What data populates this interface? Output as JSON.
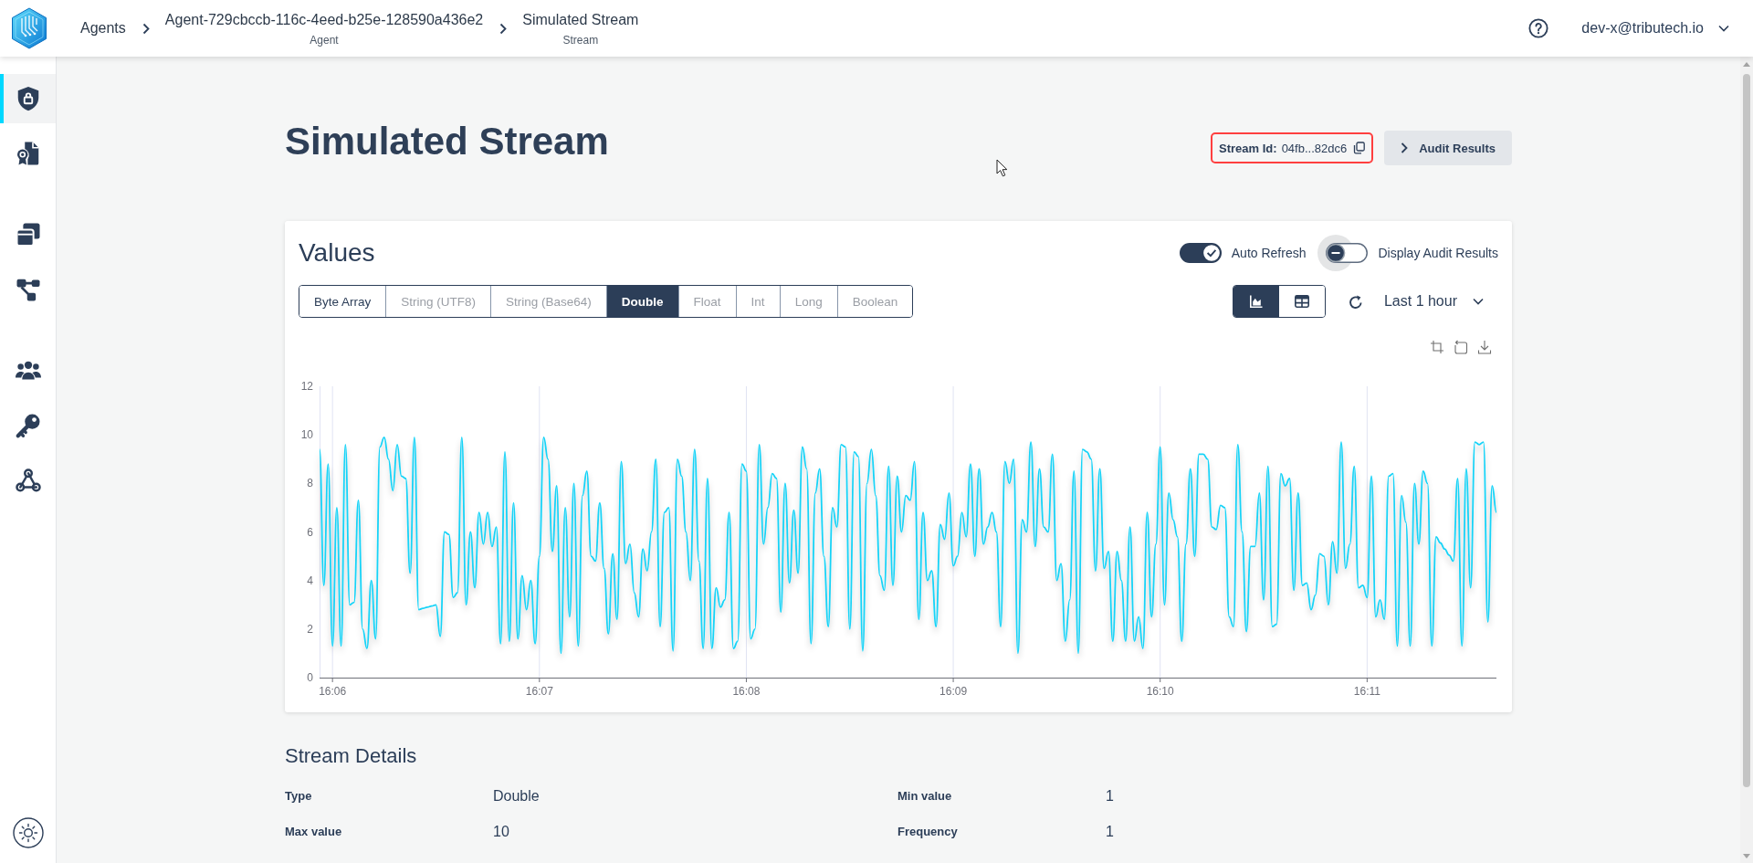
{
  "top_bar": {
    "breadcrumbs": [
      {
        "label": "Agents"
      },
      {
        "label": "Agent-729cbccb-116c-4eed-b25e-128590a436e2",
        "caption": "Agent"
      },
      {
        "label": "Simulated Stream",
        "caption": "Stream"
      }
    ],
    "user": "dev-x@tributech.io"
  },
  "sidebar": {
    "groups": [
      {
        "items": [
          {
            "selected": true
          },
          {
            "selected": false
          }
        ]
      },
      {
        "items": [
          {
            "selected": false
          },
          {
            "selected": false
          }
        ]
      },
      {
        "items": [
          {
            "selected": false
          },
          {
            "selected": false
          },
          {
            "selected": false
          }
        ]
      }
    ]
  },
  "header": {
    "title": "Simulated Stream",
    "stream_id": {
      "label": "Stream Id:",
      "value": "04fb...82dc6",
      "highlighted": true
    },
    "audit_button": "Audit Results"
  },
  "values_card": {
    "title": "Values",
    "toggles": [
      {
        "label": "Auto Refresh",
        "on": true,
        "focused": false
      },
      {
        "label": "Display Audit Results",
        "on": false,
        "focused": true
      }
    ],
    "type_tabs": [
      {
        "label": "Byte Array",
        "selected": false,
        "disabled": false
      },
      {
        "label": "String (UTF8)",
        "selected": false,
        "disabled": true
      },
      {
        "label": "String (Base64)",
        "selected": false,
        "disabled": true
      },
      {
        "label": "Double",
        "selected": true,
        "disabled": false
      },
      {
        "label": "Float",
        "selected": false,
        "disabled": true
      },
      {
        "label": "Int",
        "selected": false,
        "disabled": true
      },
      {
        "label": "Long",
        "selected": false,
        "disabled": true
      },
      {
        "label": "Boolean",
        "selected": false,
        "disabled": true
      }
    ],
    "views": [
      {
        "selected": true
      },
      {
        "selected": false
      }
    ],
    "time_range": "Last 1 hour",
    "chart_data": {
      "type": "line",
      "categories": [
        null,
        null,
        null,
        "16:06",
        null,
        null,
        null,
        null,
        null,
        null,
        null,
        null,
        null,
        null,
        null,
        null,
        null,
        null,
        null,
        null,
        null,
        null,
        null,
        null,
        null,
        null,
        null,
        null,
        null,
        null,
        null,
        null,
        null,
        null,
        null,
        null,
        null,
        null,
        null,
        null,
        null,
        null,
        null,
        null,
        null,
        null,
        null,
        null,
        null,
        null,
        null,
        "16:07",
        null,
        null,
        null,
        null,
        null,
        null,
        null,
        null,
        null,
        null,
        null,
        null,
        null,
        null,
        null,
        null,
        null,
        null,
        null,
        null,
        null,
        null,
        null,
        null,
        null,
        null,
        null,
        null,
        null,
        null,
        null,
        null,
        null,
        null,
        null,
        null,
        null,
        null,
        null,
        null,
        null,
        null,
        null,
        null,
        null,
        null,
        null,
        "16:08",
        null,
        null,
        null,
        null,
        null,
        null,
        null,
        null,
        null,
        null,
        null,
        null,
        null,
        null,
        null,
        null,
        null,
        null,
        null,
        null,
        null,
        null,
        null,
        null,
        null,
        null,
        null,
        null,
        null,
        null,
        null,
        null,
        null,
        null,
        null,
        null,
        null,
        null,
        null,
        null,
        null,
        null,
        null,
        null,
        null,
        null,
        null,
        "16:09",
        null,
        null,
        null,
        null,
        null,
        null,
        null,
        null,
        null,
        null,
        null,
        null,
        null,
        null,
        null,
        null,
        null,
        null,
        null,
        null,
        null,
        null,
        null,
        null,
        null,
        null,
        null,
        null,
        null,
        null,
        null,
        null,
        null,
        null,
        null,
        null,
        null,
        null,
        null,
        null,
        null,
        null,
        null,
        null,
        null,
        null,
        null,
        "16:10",
        null,
        null,
        null,
        null,
        null,
        null,
        null,
        null,
        null,
        null,
        null,
        null,
        null,
        null,
        null,
        null,
        null,
        null,
        null,
        null,
        null,
        null,
        null,
        null,
        null,
        null,
        null,
        null,
        null,
        null,
        null,
        null,
        null,
        null,
        null,
        null,
        null,
        null,
        null,
        null,
        null,
        null,
        null,
        null,
        null,
        null,
        null,
        "16:11",
        null,
        null,
        null,
        null,
        null,
        null,
        null,
        null,
        null,
        null,
        null,
        null,
        null,
        null,
        null,
        null,
        null,
        null,
        null,
        null,
        null,
        null,
        null,
        null,
        null,
        null,
        null,
        null,
        null,
        null
      ],
      "series": [
        {
          "color": "#19d3f7",
          "values": [
            9.4,
            3.8,
            8.8,
            1.3,
            7.0,
            1.3,
            9.6,
            3.0,
            3.1,
            7.3,
            2.0,
            1.2,
            4.0,
            1.6,
            9.5,
            9.9,
            9.0,
            7.7,
            9.6,
            8.3,
            8.2,
            4.3,
            9.9,
            2.8,
            2.85,
            2.9,
            2.95,
            3.0,
            1.7,
            6.0,
            5.9,
            3.3,
            3.5,
            9.9,
            3.0,
            6.0,
            3.7,
            6.8,
            5.5,
            6.8,
            5.4,
            6.2,
            1.4,
            9.3,
            1.5,
            7.2,
            1.6,
            4.2,
            2.8,
            4.0,
            1.4,
            5.0,
            9.9,
            9.0,
            5.2,
            7.9,
            1.0,
            7.0,
            2.5,
            8.0,
            1.3,
            7.5,
            8.5,
            5.0,
            4.8,
            7.2,
            4.5,
            1.8,
            5.1,
            2.4,
            8.9,
            4.7,
            5.5,
            3.5,
            2.5,
            5.3,
            4.4,
            6.0,
            9.0,
            2.1,
            6.8,
            7.0,
            1.1,
            9.0,
            8.3,
            6.0,
            4.0,
            9.4,
            4.8,
            1.2,
            8.2,
            1.2,
            3.7,
            2.9,
            3.2,
            6.8,
            1.2,
            1.5,
            8.8,
            8.5,
            1.6,
            2.0,
            9.6,
            5.5,
            7.0,
            8.4,
            8.2,
            2.7,
            8.0,
            3.9,
            6.9,
            4.3,
            9.5,
            8.6,
            1.4,
            7.6,
            8.6,
            5.0,
            2.1,
            7.0,
            6.2,
            9.6,
            9.5,
            2.0,
            9.3,
            9.1,
            1.1,
            8.0,
            9.4,
            7.5,
            4.2,
            3.6,
            8.7,
            3.8,
            8.3,
            6.0,
            7.5,
            7.3,
            8.9,
            2.4,
            6.8,
            4.0,
            4.4,
            2.1,
            6.3,
            5.7,
            7.6,
            4.6,
            5.0,
            6.8,
            5.8,
            8.8,
            5.0,
            8.6,
            5.5,
            6.2,
            6.8,
            6.0,
            2.1,
            8.9,
            8.0,
            9.0,
            1.0,
            6.5,
            6.0,
            9.7,
            5.4,
            8.6,
            6.2,
            6.0,
            9.2,
            4.0,
            4.7,
            1.5,
            3.2,
            8.5,
            1.0,
            9.4,
            9.3,
            9.0,
            4.4,
            8.6,
            4.5,
            5.2,
            1.5,
            5.2,
            4.0,
            1.5,
            6.2,
            1.5,
            2.5,
            1.2,
            6.8,
            2.5,
            5.5,
            9.5,
            3.0,
            7.6,
            6.5,
            5.8,
            1.5,
            5.5,
            8.6,
            5.0,
            9.2,
            9.2,
            9.0,
            6.2,
            6.1,
            7.1,
            7.0,
            2.5,
            2.1,
            9.6,
            6.0,
            1.9,
            5.4,
            5.4,
            7.6,
            3.2,
            8.7,
            2.1,
            2.2,
            8.4,
            7.9,
            8.2,
            3.6,
            7.6,
            3.8,
            3.9,
            2.8,
            3.4,
            5.1,
            5.0,
            3.0,
            5.6,
            4.3,
            9.7,
            4.5,
            5.5,
            8.7,
            3.7,
            3.8,
            3.3,
            8.3,
            2.5,
            3.2,
            2.4,
            8.3,
            8.4,
            1.3,
            7.5,
            6.4,
            1.3,
            8.0,
            5.5,
            8.5,
            8.0,
            1.3,
            5.8,
            5.55,
            5.3,
            5.05,
            4.8,
            8.2,
            1.3,
            8.6,
            3.7,
            9.7,
            9.6,
            9.7,
            2.3,
            7.9,
            6.8
          ]
        }
      ],
      "ylim": [
        0,
        12
      ],
      "yticks": [
        0,
        2,
        4,
        6,
        8,
        10,
        12
      ]
    }
  },
  "stream_details": {
    "title": "Stream Details",
    "fields": [
      {
        "label": "Type",
        "value": "Double"
      },
      {
        "label": "Min value",
        "value": "1"
      },
      {
        "label": "Max value",
        "value": "10"
      },
      {
        "label": "Frequency",
        "value": "1"
      }
    ]
  }
}
